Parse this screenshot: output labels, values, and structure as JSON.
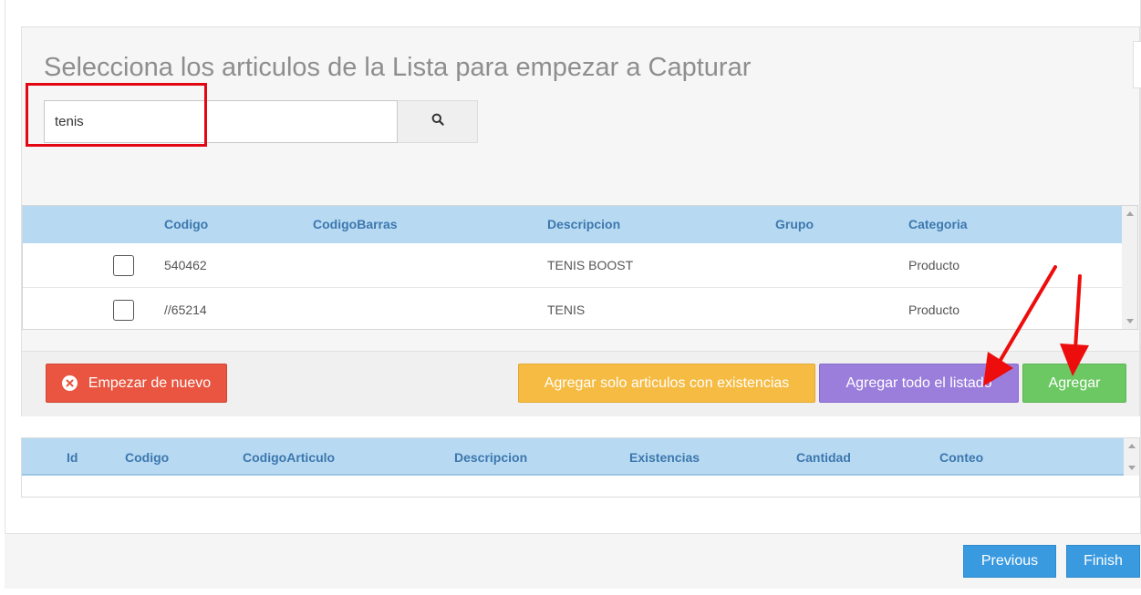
{
  "page": {
    "title": "Selecciona los articulos de la Lista para empezar a Capturar"
  },
  "search": {
    "value": "tenis"
  },
  "articles_table": {
    "headers": [
      "Codigo",
      "CodigoBarras",
      "Descripcion",
      "Grupo",
      "Categoria"
    ],
    "rows": [
      {
        "codigo": "540462",
        "codigo_barras": "",
        "descripcion": "TENIS BOOST",
        "grupo": "",
        "categoria": "Producto"
      },
      {
        "codigo": "//65214",
        "codigo_barras": "",
        "descripcion": "TENIS",
        "grupo": "",
        "categoria": "Producto"
      }
    ]
  },
  "actions": {
    "reset_label": "Empezar de nuevo",
    "add_stock_only_label": "Agregar solo articulos con existencias",
    "add_all_label": "Agregar todo el listado",
    "add_label": "Agregar"
  },
  "capture_table": {
    "headers": [
      "Id",
      "Codigo",
      "CodigoArticulo",
      "Descripcion",
      "Existencias",
      "Cantidad",
      "Conteo"
    ]
  },
  "wizard": {
    "previous_label": "Previous",
    "finish_label": "Finish"
  },
  "colors": {
    "annotation_red": "#e30613",
    "header_blue": "#b7daf2",
    "btn_red": "#e95540",
    "btn_yellow": "#f6bb42",
    "btn_purple": "#9b7ddc",
    "btn_green": "#6bc862",
    "btn_blue": "#3a9ae0"
  }
}
